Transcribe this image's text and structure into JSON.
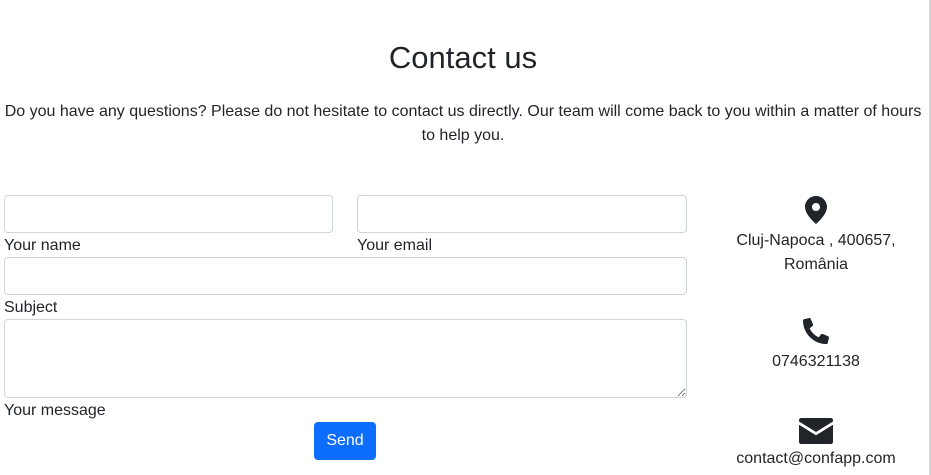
{
  "page": {
    "title": "Contact us",
    "intro": "Do you have any questions? Please do not hesitate to contact us directly. Our team will come back to you within a matter of hours to help you."
  },
  "form": {
    "name_label": "Your name",
    "email_label": "Your email",
    "subject_label": "Subject",
    "message_label": "Your message",
    "name_value": "",
    "email_value": "",
    "subject_value": "",
    "message_value": "",
    "send_label": "Send"
  },
  "contact_info": {
    "address_line1": "Cluj-Napoca , 400657,",
    "address_line2": "România",
    "phone": "0746321138",
    "email": "contact@confapp.com",
    "icons": [
      "map-marker-icon",
      "phone-icon",
      "envelope-icon"
    ]
  },
  "colors": {
    "primary_button": "#0d6efd",
    "text": "#212529",
    "input_border": "#ced4da"
  }
}
